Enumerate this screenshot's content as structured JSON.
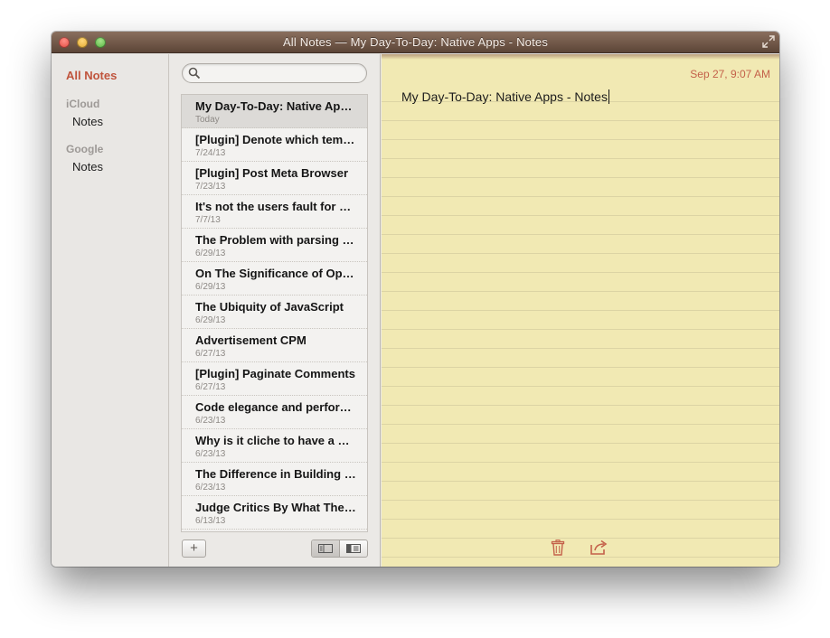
{
  "window": {
    "title": "All Notes — My Day-To-Day: Native Apps - Notes"
  },
  "sidebar": {
    "all_notes": "All Notes",
    "accounts": [
      {
        "name": "iCloud",
        "folders": [
          "Notes"
        ]
      },
      {
        "name": "Google",
        "folders": [
          "Notes"
        ]
      }
    ]
  },
  "search": {
    "placeholder": ""
  },
  "notes": [
    {
      "title": "My Day-To-Day: Native Apps - Notes",
      "date": "Today"
    },
    {
      "title": "[Plugin] Denote which template files are used",
      "date": "7/24/13"
    },
    {
      "title": "[Plugin] Post Meta Browser",
      "date": "7/23/13"
    },
    {
      "title": "It's not the users fault for not understanding",
      "date": "7/7/13"
    },
    {
      "title": "The Problem with parsing HTML",
      "date": "6/29/13"
    },
    {
      "title": "On The Significance of Open Source",
      "date": "6/29/13"
    },
    {
      "title": "The Ubiquity of JavaScript",
      "date": "6/29/13"
    },
    {
      "title": "Advertisement CPM",
      "date": "6/27/13"
    },
    {
      "title": "[Plugin] Paginate Comments",
      "date": "6/27/13"
    },
    {
      "title": "Code elegance and performance",
      "date": "6/23/13"
    },
    {
      "title": "Why is it cliche to have a blog",
      "date": "6/23/13"
    },
    {
      "title": "The Difference in Building Products",
      "date": "6/23/13"
    },
    {
      "title": "Judge Critics By What They Create",
      "date": "6/13/13"
    }
  ],
  "list_footer": {
    "add_label": "+"
  },
  "editor": {
    "date": "Sep 27, 9:07 AM",
    "body": "My Day-To-Day: Native Apps - Notes"
  },
  "icons": {
    "trash": "trash-icon",
    "share": "share-icon",
    "fullscreen": "fullscreen-icon",
    "search": "search-icon"
  },
  "colors": {
    "accent": "#c0543c",
    "titlebar": "#6b5244",
    "paper": "#f1e9b3"
  }
}
